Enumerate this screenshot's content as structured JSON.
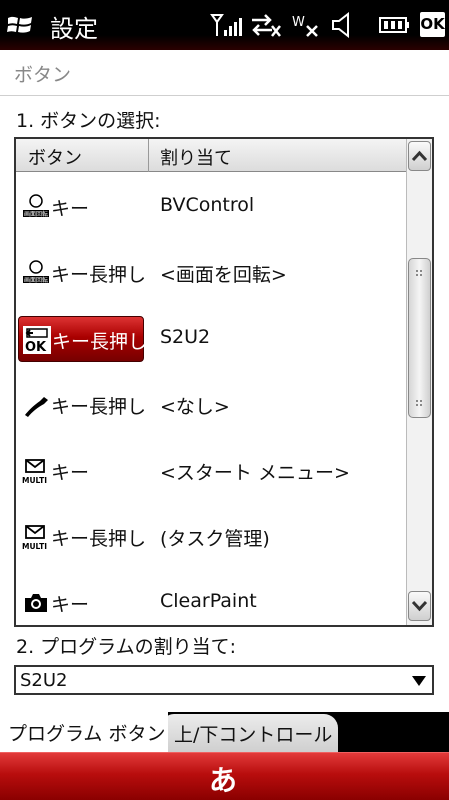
{
  "statusbar": {
    "title": "設定",
    "ok_label": "OK"
  },
  "subheader": {
    "title": "ボタン"
  },
  "section1": {
    "label": "1. ボタンの選択:"
  },
  "list": {
    "headers": {
      "button": "ボタン",
      "assignment": "割り当て"
    },
    "rows": [
      {
        "icon": "rotate-screen-icon",
        "button": "キー",
        "assignment": "BVControl",
        "selected": false
      },
      {
        "icon": "rotate-screen-icon",
        "button": "キー長押し",
        "assignment": "<画面を回転>",
        "selected": false
      },
      {
        "icon": "ok-back-icon",
        "button": "キー長押し",
        "assignment": "S2U2",
        "selected": true
      },
      {
        "icon": "phone-end-icon",
        "button": "キー長押し",
        "assignment": "<なし>",
        "selected": false
      },
      {
        "icon": "multi-mail-icon",
        "button": "キー",
        "assignment": "<スタート メニュー>",
        "selected": false
      },
      {
        "icon": "multi-mail-icon",
        "button": "キー長押し",
        "assignment": "(タスク管理)",
        "selected": false
      },
      {
        "icon": "camera-icon",
        "button": "キー",
        "assignment": "ClearPaint",
        "selected": false
      }
    ]
  },
  "section2": {
    "label": "2. プログラムの割り当て:"
  },
  "program_select": {
    "value": "S2U2"
  },
  "tabs": [
    {
      "label": "プログラム ボタン",
      "active": true
    },
    {
      "label": "上/下コントロール",
      "active": false
    }
  ],
  "softkey": {
    "label": "あ"
  }
}
